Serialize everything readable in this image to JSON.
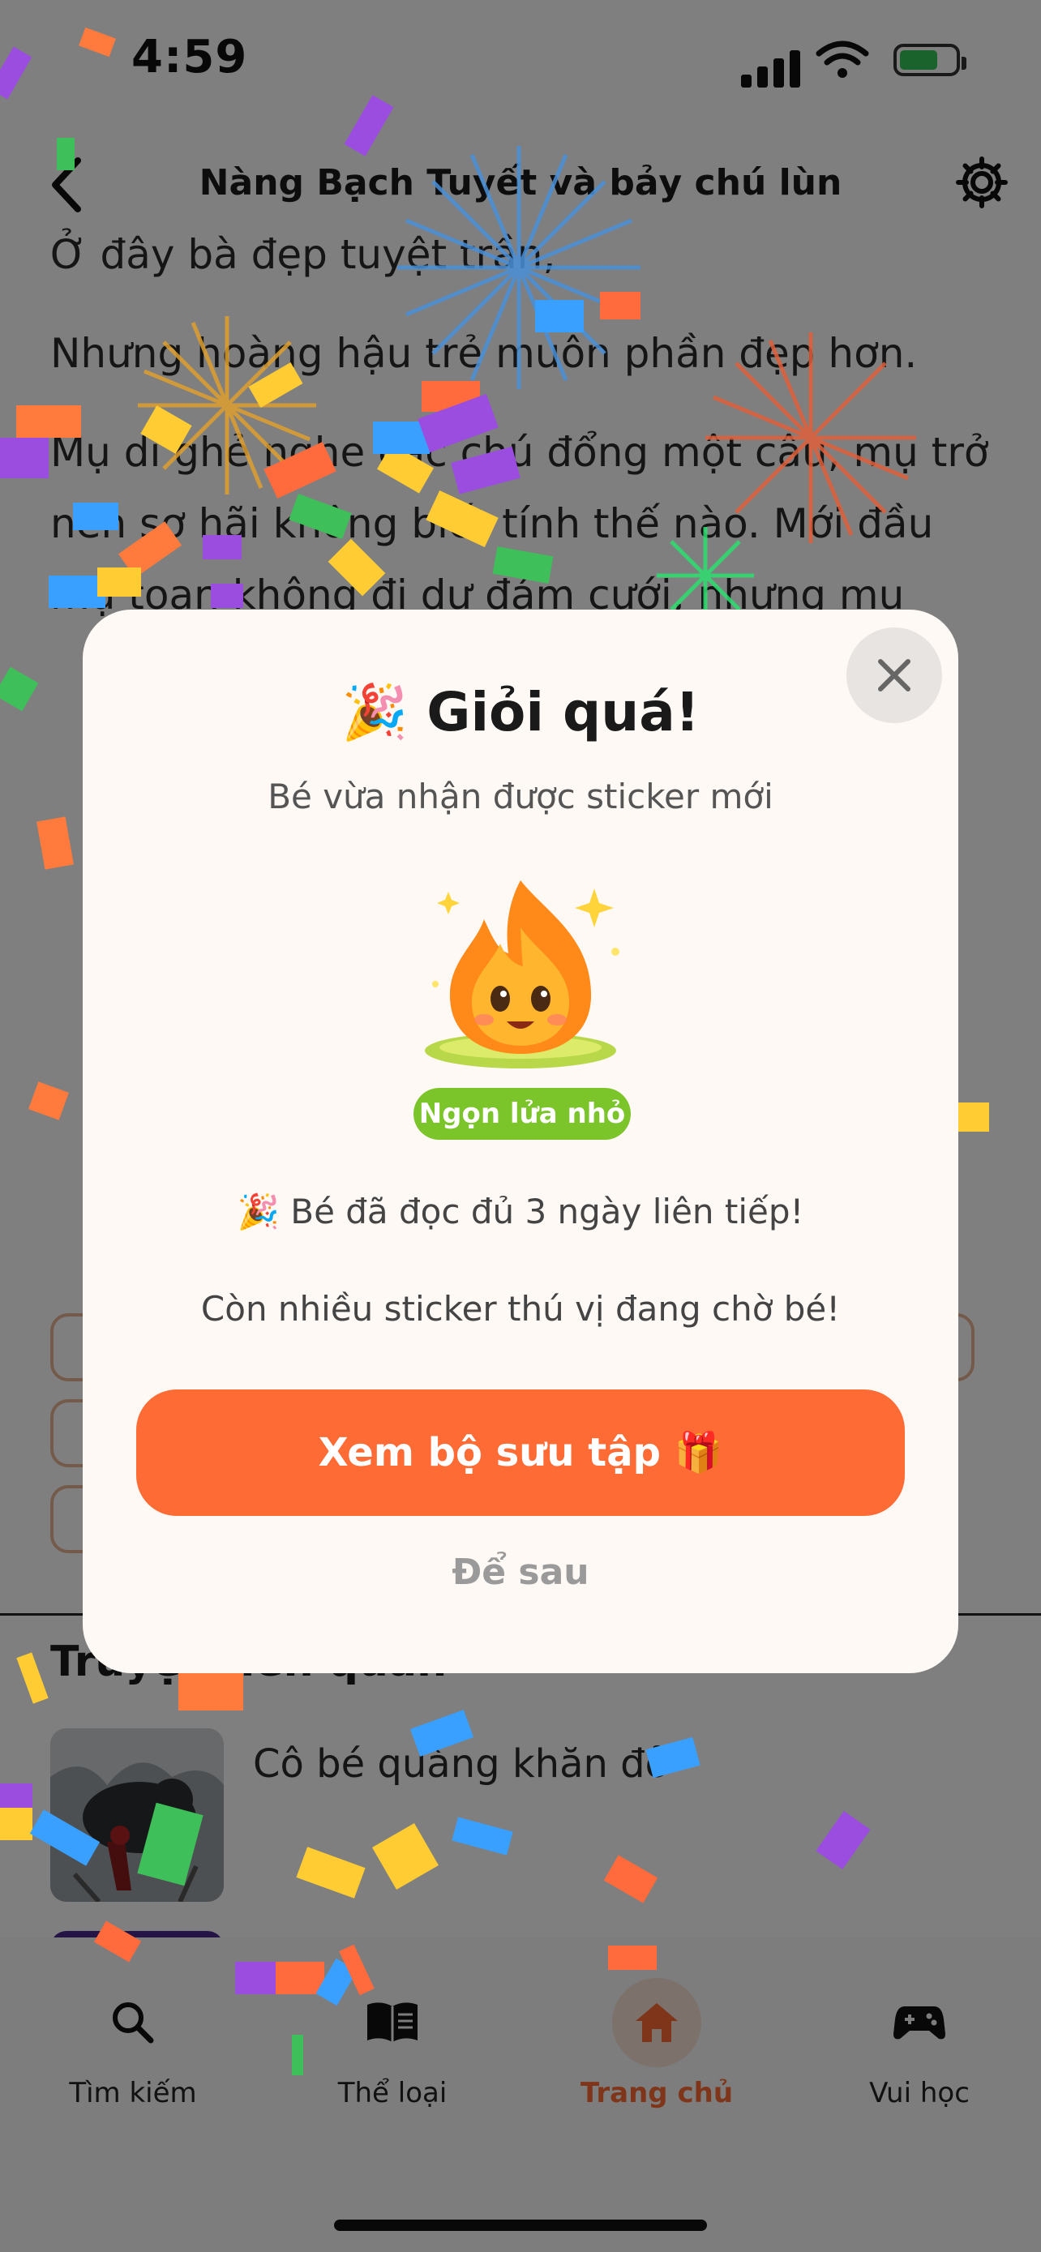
{
  "status": {
    "time": "4:59"
  },
  "header": {
    "title": "Nàng Bạch Tuyết và bảy chú lùn"
  },
  "story": {
    "paragraphs": [
      "Ở đây bà đẹp tuyệt trần,",
      "Nhưng hoàng hậu trẻ muôn phần đẹp hơn.",
      "Mụ dì ghẻ nghe các chú đổng một câu, mụ trở nên sợ hãi không biết tính thế nào. Mới đầu mụ toan không đi dự đám cưới, nhưng mụ"
    ]
  },
  "related": {
    "title": "Truyện liên quan",
    "items": [
      {
        "name": "Cô bé quàng khăn đỏ"
      }
    ]
  },
  "modal": {
    "title": "🎉 Giỏi quá!",
    "subtitle": "Bé vừa nhận được sticker mới",
    "sticker_name": "Ngọn lửa nhỏ",
    "streak_text": "🎉  Bé đã đọc đủ 3 ngày liên tiếp!",
    "more_text": "Còn nhiều sticker thú vị đang chờ bé!",
    "primary_button": "Xem bộ sưu tập 🎁",
    "secondary_button": "Để sau",
    "close_icon": "close-icon"
  },
  "tabs": [
    {
      "label": "Tìm kiếm",
      "icon": "search-icon",
      "active": false
    },
    {
      "label": "Thể loại",
      "icon": "book-icon",
      "active": false
    },
    {
      "label": "Trang chủ",
      "icon": "home-icon",
      "active": true
    },
    {
      "label": "Vui học",
      "icon": "gamepad-icon",
      "active": false
    }
  ],
  "colors": {
    "accent": "#ff6b35",
    "badge_green": "#7bc52a",
    "modal_bg": "#fff9f5",
    "overlay": "rgba(0,0,0,0.5)"
  }
}
